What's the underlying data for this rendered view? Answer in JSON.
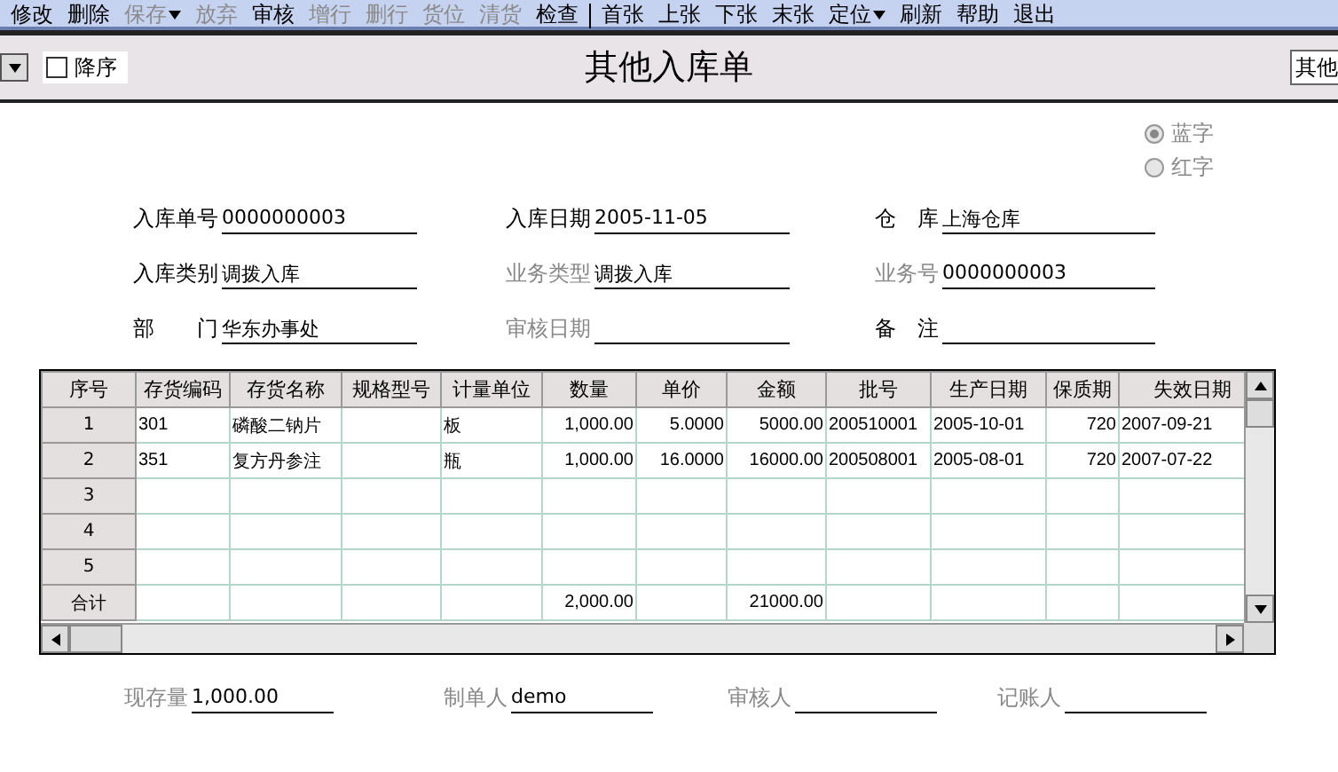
{
  "toolbar": [
    {
      "label": "修改",
      "disabled": false
    },
    {
      "label": "删除",
      "disabled": false
    },
    {
      "label": "保存",
      "disabled": true,
      "dropdown": true
    },
    {
      "label": "放弃",
      "disabled": true
    },
    {
      "label": "审核",
      "disabled": false
    },
    {
      "label": "增行",
      "disabled": true
    },
    {
      "label": "删行",
      "disabled": true
    },
    {
      "label": "货位",
      "disabled": true
    },
    {
      "label": "清货",
      "disabled": true
    },
    {
      "label": "检查",
      "disabled": false,
      "separator_after": true
    },
    {
      "label": "首张",
      "disabled": false
    },
    {
      "label": "上张",
      "disabled": false
    },
    {
      "label": "下张",
      "disabled": false
    },
    {
      "label": "末张",
      "disabled": false
    },
    {
      "label": "定位",
      "disabled": false,
      "dropdown": true
    },
    {
      "label": "刷新",
      "disabled": false
    },
    {
      "label": "帮助",
      "disabled": false
    },
    {
      "label": "退出",
      "disabled": false
    }
  ],
  "header": {
    "sort_desc": {
      "label": "降序",
      "checked": false
    },
    "title": "其他入库单",
    "template_field": "其他"
  },
  "color_mode": [
    {
      "label": "蓝字",
      "selected": true
    },
    {
      "label": "红字",
      "selected": false
    }
  ],
  "fields": [
    {
      "label": "入库单号",
      "value": "0000000003",
      "disabled": false
    },
    {
      "label": "入库日期",
      "value": "2005-11-05",
      "disabled": false
    },
    {
      "label": "仓　库",
      "value": "上海仓库",
      "disabled": false
    },
    {
      "label": "入库类别",
      "value": "调拨入库",
      "disabled": false
    },
    {
      "label": "业务类型",
      "value": "调拨入库",
      "disabled": true
    },
    {
      "label": "业务号",
      "value": "0000000003",
      "disabled": true
    },
    {
      "label": "部　　门",
      "value": "华东办事处",
      "disabled": false
    },
    {
      "label": "审核日期",
      "disabled": true
    },
    {
      "label": "备　注",
      "disabled": false
    }
  ],
  "table": {
    "columns": [
      {
        "label": "序号"
      },
      {
        "label": "存货编码"
      },
      {
        "label": "存货名称"
      },
      {
        "label": "规格型号"
      },
      {
        "label": "计量单位"
      },
      {
        "label": "数量",
        "numeric": true
      },
      {
        "label": "单价",
        "numeric": true
      },
      {
        "label": "金额",
        "numeric": true
      },
      {
        "label": "批号"
      },
      {
        "label": "生产日期"
      },
      {
        "label": "保质期",
        "numeric": true
      },
      {
        "label": "失效日期"
      }
    ],
    "rows": [
      [
        "1",
        "301",
        "磷酸二钠片",
        "",
        "板",
        "1,000.00",
        "5.0000",
        "5000.00",
        "200510001",
        "2005-10-01",
        "720",
        "2007-09-21"
      ],
      [
        "2",
        "351",
        "复方丹参注",
        "",
        "瓶",
        "1,000.00",
        "16.0000",
        "16000.00",
        "200508001",
        "2005-08-01",
        "720",
        "2007-07-22"
      ],
      [
        "3",
        "",
        "",
        "",
        "",
        "",
        "",
        "",
        "",
        "",
        "",
        ""
      ],
      [
        "4",
        "",
        "",
        "",
        "",
        "",
        "",
        "",
        "",
        "",
        "",
        ""
      ],
      [
        "5",
        "",
        "",
        "",
        "",
        "",
        "",
        "",
        "",
        "",
        "",
        ""
      ],
      [
        "合计",
        "",
        "",
        "",
        "",
        "2,000.00",
        "",
        "21000.00",
        "",
        "",
        "",
        ""
      ]
    ]
  },
  "footer": [
    {
      "label": "现存量",
      "value": "1,000.00"
    },
    {
      "label": "制单人",
      "value": "demo"
    },
    {
      "label": "审核人"
    },
    {
      "label": "记账人"
    }
  ]
}
